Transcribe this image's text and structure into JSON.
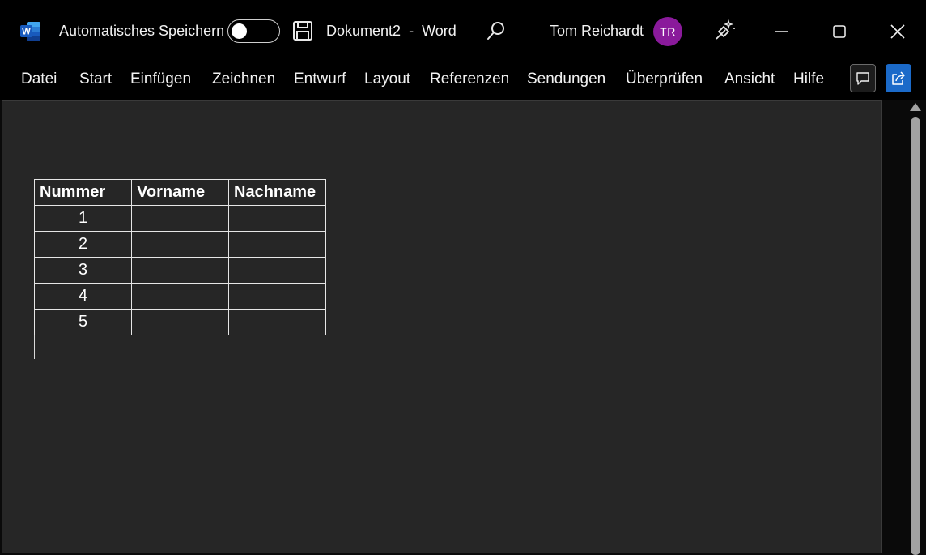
{
  "titlebar": {
    "app_icon": "word-app-icon",
    "autosave_label": "Automatisches Speichern",
    "autosave_state": "off",
    "save_icon": "save-icon",
    "document_name": "Dokument2",
    "separator": "-",
    "app_name": "Word",
    "search_icon": "search-icon",
    "user_name": "Tom Reichardt",
    "user_initials": "TR",
    "avatar_color": "#8a1a9b",
    "designer_icon": "designer-wand-icon",
    "window_controls": [
      "minimize",
      "maximize",
      "close"
    ]
  },
  "ribbon": {
    "tabs": [
      {
        "label": "Datei"
      },
      {
        "label": "Start"
      },
      {
        "label": "Einfügen"
      },
      {
        "label": "Zeichnen"
      },
      {
        "label": "Entwurf"
      },
      {
        "label": "Layout"
      },
      {
        "label": "Referenzen"
      },
      {
        "label": "Sendungen"
      },
      {
        "label": "Überprüfen"
      },
      {
        "label": "Ansicht"
      },
      {
        "label": "Hilfe"
      }
    ],
    "comment_icon": "comment-icon",
    "share_icon": "share-icon",
    "share_color": "#1b6ac9"
  },
  "document": {
    "table": {
      "headers": [
        "Nummer",
        "Vorname",
        "Nachname"
      ],
      "rows": [
        [
          "1",
          "",
          ""
        ],
        [
          "2",
          "",
          ""
        ],
        [
          "3",
          "",
          ""
        ],
        [
          "4",
          "",
          ""
        ],
        [
          "5",
          "",
          ""
        ]
      ]
    }
  }
}
